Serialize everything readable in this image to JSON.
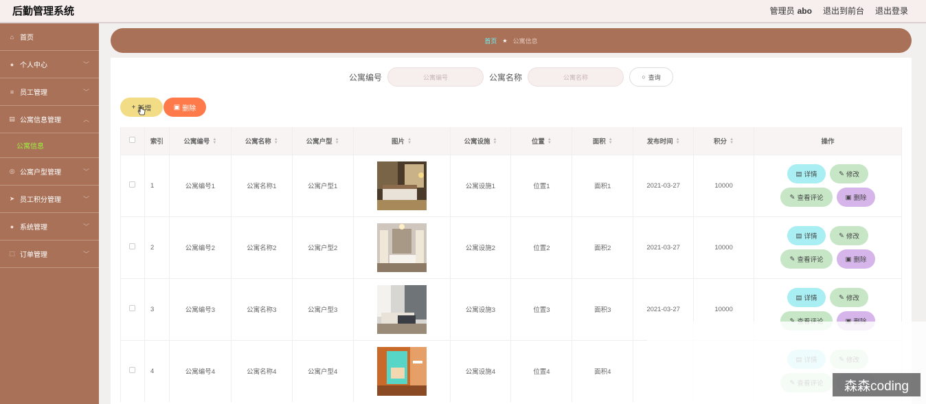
{
  "header": {
    "title": "后勤管理系统",
    "admin_label": "管理员",
    "admin_name": "abo",
    "back_front": "退出到前台",
    "logout": "退出登录"
  },
  "sidebar": {
    "items": [
      {
        "label": "首页",
        "icon": "home-icon"
      },
      {
        "label": "个人中心",
        "icon": "user-icon"
      },
      {
        "label": "员工管理",
        "icon": "list-icon"
      },
      {
        "label": "公寓信息管理",
        "icon": "clipboard-icon"
      },
      {
        "label": "公寓户型管理",
        "icon": "target-icon"
      },
      {
        "label": "员工积分管理",
        "icon": "send-icon"
      },
      {
        "label": "系统管理",
        "icon": "user-icon"
      },
      {
        "label": "订单管理",
        "icon": "frame-icon"
      }
    ],
    "active_sub": "公寓信息"
  },
  "breadcrumb": {
    "home": "首页",
    "separator": "★",
    "current": "公寓信息"
  },
  "search": {
    "field1_label": "公寓编号",
    "field1_placeholder": "公寓编号",
    "field2_label": "公寓名称",
    "field2_placeholder": "公寓名称",
    "button": "查询"
  },
  "actions": {
    "add": "新增",
    "delete": "删除"
  },
  "table": {
    "columns": [
      "索引",
      "公寓编号",
      "公寓名称",
      "公寓户型",
      "图片",
      "公寓设施",
      "位置",
      "面积",
      "发布时间",
      "积分",
      "操作"
    ],
    "rows": [
      {
        "index": "1",
        "code": "公寓编号1",
        "name": "公寓名称1",
        "type": "公寓户型1",
        "facility": "公寓设施1",
        "location": "位置1",
        "area": "面积1",
        "date": "2021-03-27",
        "points": "10000"
      },
      {
        "index": "2",
        "code": "公寓编号2",
        "name": "公寓名称2",
        "type": "公寓户型2",
        "facility": "公寓设施2",
        "location": "位置2",
        "area": "面积2",
        "date": "2021-03-27",
        "points": "10000"
      },
      {
        "index": "3",
        "code": "公寓编号3",
        "name": "公寓名称3",
        "type": "公寓户型3",
        "facility": "公寓设施3",
        "location": "位置3",
        "area": "面积3",
        "date": "2021-03-27",
        "points": "10000"
      },
      {
        "index": "4",
        "code": "公寓编号4",
        "name": "公寓名称4",
        "type": "公寓户型4",
        "facility": "公寓设施4",
        "location": "位置4",
        "area": "面积4",
        "date": "",
        "points": ""
      }
    ],
    "ops": {
      "detail": "详情",
      "edit": "修改",
      "comment": "查看评论",
      "remove": "删除"
    }
  },
  "watermark": "森森coding",
  "colors": {
    "sidebar": "#a87158",
    "header_bg": "#f7eeee",
    "active_sub": "#9ff23f",
    "add_button": "#f2dd86",
    "delete_button": "#ff7a4a"
  }
}
